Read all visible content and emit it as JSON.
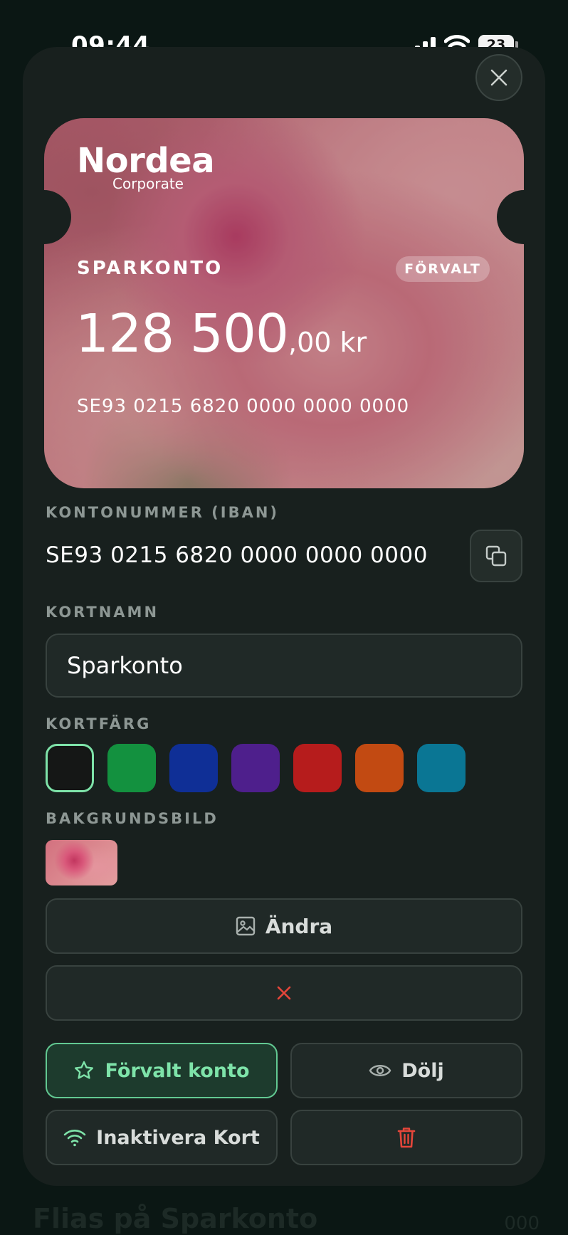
{
  "status_bar": {
    "time": "09:44",
    "battery_level": "23",
    "icons": [
      "signal-icon",
      "wifi-icon",
      "battery-icon"
    ]
  },
  "card": {
    "bank_logo": "Nordea",
    "bank_sublabel": "Corporate",
    "account_name": "SPARKONTO",
    "default_badge": "FÖRVALT",
    "balance_main": "128 500",
    "balance_decimals": ",00 kr",
    "iban": "SE93 0215 6820 0000 0000 0000"
  },
  "iban_section": {
    "label": "KONTONUMMER (IBAN)",
    "value": "SE93 0215 6820 0000 0000 0000",
    "copy_icon": "copy-icon"
  },
  "card_name_section": {
    "label": "KORTNAMN",
    "value": "Sparkonto"
  },
  "card_color_section": {
    "label": "KORTFÄRG",
    "colors": [
      "#151716",
      "#13913f",
      "#0f2f96",
      "#4e1f8c",
      "#b61c1c",
      "#c24a12",
      "#0a7694"
    ],
    "selected_index": 0,
    "selected_outline": "#7ee3a9"
  },
  "background_section": {
    "label": "BAKGRUNDSBILD",
    "change_label": "Ändra",
    "change_icon": "image-icon",
    "remove_icon": "x-icon"
  },
  "actions": {
    "default_account_label": "Förvalt konto",
    "default_account_icon": "star-icon",
    "hide_label": "Dölj",
    "hide_icon": "eye-icon",
    "deactivate_label": "Inaktivera Kort",
    "deactivate_icon": "contactless-icon",
    "delete_icon": "trash-icon"
  },
  "background_page": {
    "title": "Flias på Sparkonto",
    "value": "000"
  },
  "colors": {
    "sheet_bg": "#18201e",
    "accent_green": "#7ee3a9",
    "danger_red": "#e5463a"
  }
}
